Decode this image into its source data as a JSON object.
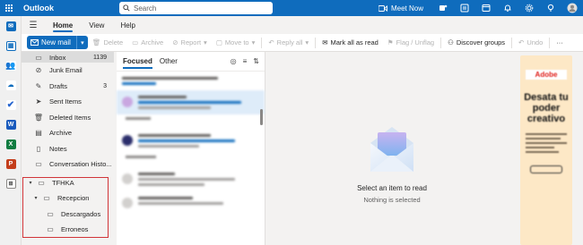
{
  "app": {
    "title": "Outlook",
    "search_placeholder": "Search",
    "meet_now": "Meet Now"
  },
  "tabs": [
    "Home",
    "View",
    "Help"
  ],
  "ribbon": {
    "new_mail": "New mail",
    "delete": "Delete",
    "archive": "Archive",
    "report": "Report",
    "move_to": "Move to",
    "reply_all": "Reply all",
    "mark_all_read": "Mark all as read",
    "flag_unflag": "Flag / Unflag",
    "discover_groups": "Discover groups",
    "undo": "Undo",
    "more": "···"
  },
  "folders": [
    {
      "label": "Inbox",
      "count": "1139",
      "icon": "inbox-icon"
    },
    {
      "label": "Junk Email",
      "count": "",
      "icon": "junk-icon"
    },
    {
      "label": "Drafts",
      "count": "3",
      "icon": "pencil-icon"
    },
    {
      "label": "Sent Items",
      "count": "",
      "icon": "send-icon"
    },
    {
      "label": "Deleted Items",
      "count": "",
      "icon": "trash-icon"
    },
    {
      "label": "Archive",
      "count": "",
      "icon": "archive-icon"
    },
    {
      "label": "Notes",
      "count": "",
      "icon": "note-icon"
    },
    {
      "label": "Conversation Histo...",
      "count": "",
      "icon": "folder-icon"
    }
  ],
  "custom_folders": {
    "root": "TFHKA",
    "child": "Recepcion",
    "grandchildren": [
      "Descargados",
      "Erroneos"
    ]
  },
  "message_list": {
    "focused": "Focused",
    "other": "Other"
  },
  "reading_pane": {
    "title": "Select an item to read",
    "subtitle": "Nothing is selected"
  },
  "ad": {
    "brand": "Adobe",
    "headline": "Desata tu poder creativo"
  },
  "colors": {
    "accent": "#0f6cbd",
    "highlight_box": "#d13438"
  }
}
